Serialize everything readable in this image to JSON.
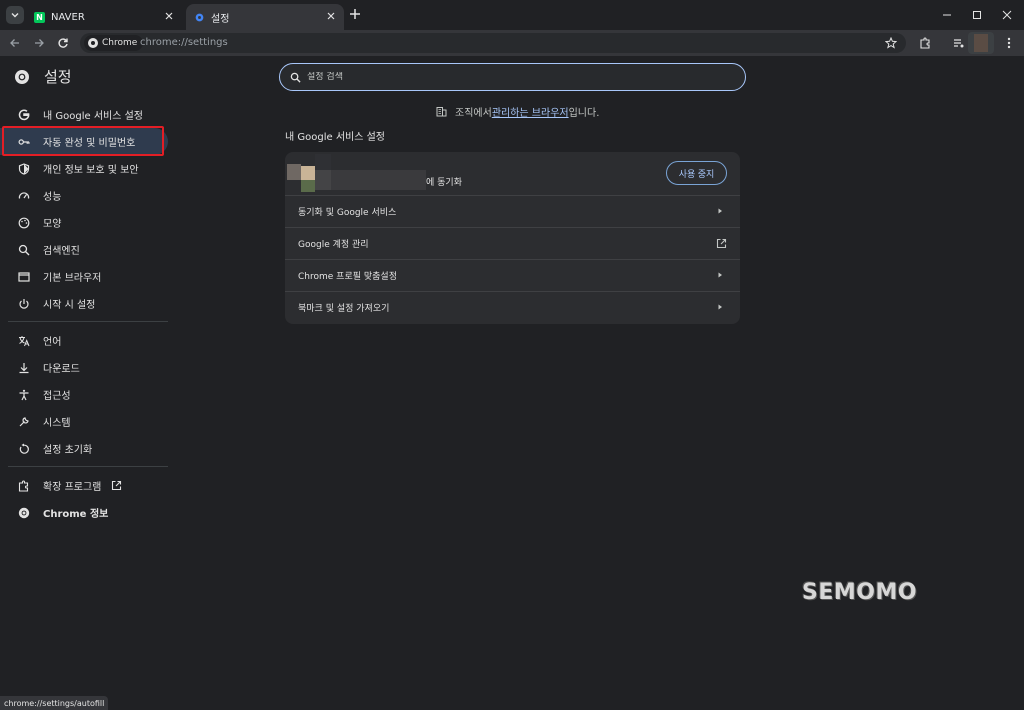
{
  "tabs": [
    {
      "title": "NAVER"
    },
    {
      "title": "설정"
    }
  ],
  "toolbar": {
    "chip_label": "Chrome",
    "url": "chrome://settings"
  },
  "sidebar": {
    "title": "설정",
    "items": [
      {
        "label": "내 Google 서비스 설정",
        "icon": "google-g-icon"
      },
      {
        "label": "자동 완성 및 비밀번호",
        "icon": "key-icon"
      },
      {
        "label": "개인 정보 보호 및 보안",
        "icon": "shield-icon"
      },
      {
        "label": "성능",
        "icon": "speedometer-icon"
      },
      {
        "label": "모양",
        "icon": "palette-icon"
      },
      {
        "label": "검색엔진",
        "icon": "search-icon"
      },
      {
        "label": "기본 브라우저",
        "icon": "browser-icon"
      },
      {
        "label": "시작 시 설정",
        "icon": "power-icon"
      },
      {
        "label": "언어",
        "icon": "translate-icon"
      },
      {
        "label": "다운로드",
        "icon": "download-icon"
      },
      {
        "label": "접근성",
        "icon": "accessibility-icon"
      },
      {
        "label": "시스템",
        "icon": "wrench-icon"
      },
      {
        "label": "설정 초기화",
        "icon": "reset-icon"
      },
      {
        "label": "확장 프로그램",
        "icon": "extension-icon"
      },
      {
        "label": "Chrome 정보",
        "icon": "chrome-icon"
      }
    ]
  },
  "search": {
    "placeholder": "설정 검색"
  },
  "managed": {
    "prefix": "조직에서 ",
    "link": "관리하는 브라우저",
    "suffix": "입니다."
  },
  "main": {
    "section_title": "내 Google 서비스 설정",
    "sync_text": "에 동기화",
    "stop_button": "사용 중지",
    "rows": [
      {
        "label": "동기화 및 Google 서비스"
      },
      {
        "label": "Google 계정 관리"
      },
      {
        "label": "Chrome 프로필 맞춤설정"
      },
      {
        "label": "북마크 및 설정 가져오기"
      }
    ]
  },
  "watermark": "SEMOMO",
  "status_url": "chrome://settings/autofill",
  "colors": {
    "accent": "#a8c7fa",
    "highlight_box": "#e31e25",
    "background": "#202124"
  }
}
